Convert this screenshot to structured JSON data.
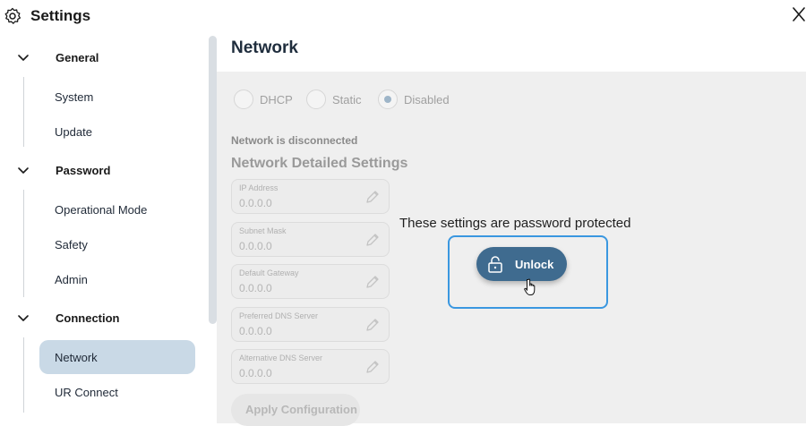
{
  "header": {
    "title": "Settings",
    "settings_icon": "gear-icon",
    "close_icon": "close-icon"
  },
  "sidebar": {
    "groups": [
      {
        "label": "General",
        "icon": "chevron-down-icon",
        "items": [
          {
            "label": "System"
          },
          {
            "label": "Update"
          }
        ]
      },
      {
        "label": "Password",
        "icon": "chevron-down-icon",
        "items": [
          {
            "label": "Operational Mode"
          },
          {
            "label": "Safety"
          },
          {
            "label": "Admin"
          }
        ]
      },
      {
        "label": "Connection",
        "icon": "chevron-down-icon",
        "items": [
          {
            "label": "Network",
            "active": true
          },
          {
            "label": "UR Connect"
          }
        ]
      }
    ]
  },
  "main": {
    "title": "Network",
    "mode_options": [
      {
        "label": "DHCP",
        "checked": false
      },
      {
        "label": "Static",
        "checked": false
      },
      {
        "label": "Disabled",
        "checked": true
      }
    ],
    "status": "Network is disconnected",
    "section_title": "Network Detailed Settings",
    "fields": [
      {
        "label": "IP Address",
        "value": "0.0.0.0"
      },
      {
        "label": "Subnet Mask",
        "value": "0.0.0.0"
      },
      {
        "label": "Default Gateway",
        "value": "0.0.0.0"
      },
      {
        "label": "Preferred DNS Server",
        "value": "0.0.0.0"
      },
      {
        "label": "Alternative DNS Server",
        "value": "0.0.0.0"
      }
    ],
    "apply_label": "Apply Configuration",
    "protected_message": "These settings are password protected",
    "unlock_label": "Unlock",
    "lock_icon": "lock-icon",
    "edit_icon": "pencil-icon"
  },
  "colors": {
    "accent": "#3f6b8f",
    "focus_ring": "#3a97e0",
    "active_nav": "#c9d9e6",
    "content_bg": "#efefef"
  }
}
